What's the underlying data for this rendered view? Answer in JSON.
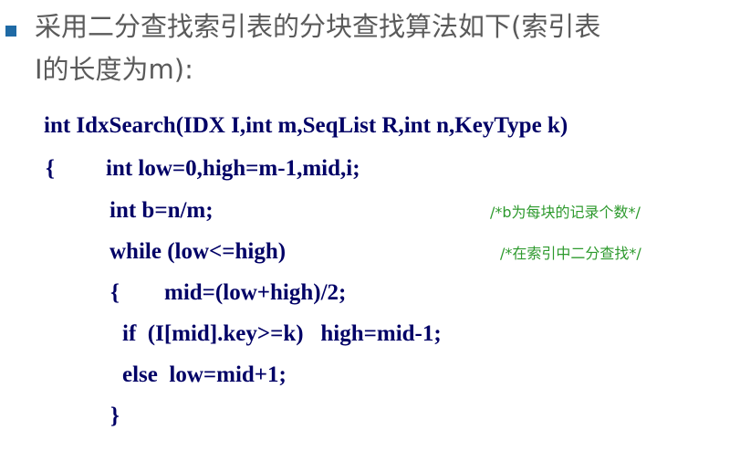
{
  "bullet_color": "#1f6aa5",
  "heading": {
    "line1": "采用二分查找索引表的分块查找算法如下(索引表",
    "line2": "I的长度为m):"
  },
  "code": {
    "line1": "int IdxSearch(IDX I,int m,SeqList R,int n,KeyType k)",
    "line2_brace": "{",
    "line2": "int low=0,high=m-1,mid,i;",
    "line3": "int b=n/m;",
    "line4": "while (low<=high)",
    "line5_brace": "{",
    "line5": "mid=(low+high)/2;",
    "line6": "if  (I[mid].key>=k)   high=mid-1;",
    "line7": "else  low=mid+1;",
    "line8": "}"
  },
  "comments": {
    "c1": "/*b为每块的记录个数*/",
    "c2": "/*在索引中二分查找*/"
  },
  "colors": {
    "code": "#000066",
    "comment": "#2e9a2e",
    "heading": "#5a5a5a"
  }
}
